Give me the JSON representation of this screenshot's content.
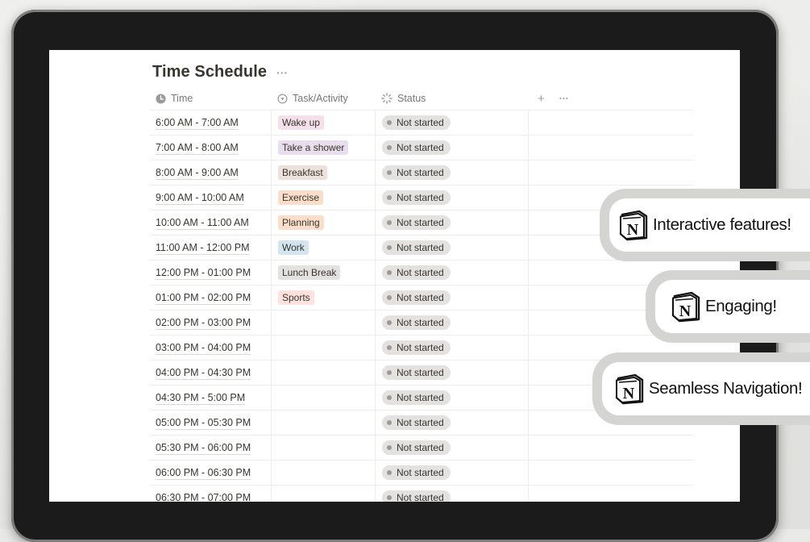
{
  "page": {
    "title": "Time Schedule",
    "title_more": "···"
  },
  "table": {
    "columns": {
      "time": "Time",
      "task": "Task/Activity",
      "status": "Status",
      "add": "+",
      "more": "···"
    },
    "rows": [
      {
        "time": "6:00 AM - 7:00 AM",
        "task": "Wake up",
        "task_color": "#f5e0e9",
        "status": "Not started"
      },
      {
        "time": "7:00 AM - 8:00 AM",
        "task": "Take a shower",
        "task_color": "#e8deee",
        "status": "Not started"
      },
      {
        "time": "8:00 AM - 9:00 AM",
        "task": "Breakfast",
        "task_color": "#eee0da",
        "status": "Not started"
      },
      {
        "time": "9:00 AM - 10:00 AM",
        "task": "Exercise",
        "task_color": "#fadec9",
        "status": "Not started"
      },
      {
        "time": "10:00 AM - 11:00 AM",
        "task": "Planning",
        "task_color": "#fadec9",
        "status": "Not started"
      },
      {
        "time": "11:00 AM - 12:00 PM",
        "task": "Work",
        "task_color": "#d3e5ef",
        "status": "Not started"
      },
      {
        "time": "12:00 PM - 01:00 PM",
        "task": "Lunch Break",
        "task_color": "#e3e2e0",
        "status": "Not started"
      },
      {
        "time": "01:00 PM - 02:00 PM",
        "task": "Sports",
        "task_color": "#ffe2dd",
        "status": "Not started"
      },
      {
        "time": "02:00 PM - 03:00 PM",
        "task": "",
        "task_color": "",
        "status": "Not started"
      },
      {
        "time": "03:00 PM - 04:00 PM",
        "task": "",
        "task_color": "",
        "status": "Not started"
      },
      {
        "time": "04:00 PM - 04:30 PM",
        "task": "",
        "task_color": "",
        "status": "Not started"
      },
      {
        "time": "04:30 PM - 5:00 PM",
        "task": "",
        "task_color": "",
        "status": "Not started"
      },
      {
        "time": "05:00 PM - 05:30 PM",
        "task": "",
        "task_color": "",
        "status": "Not started"
      },
      {
        "time": "05:30 PM - 06:00 PM",
        "task": "",
        "task_color": "",
        "status": "Not started"
      },
      {
        "time": "06:00 PM - 06:30 PM",
        "task": "",
        "task_color": "",
        "status": "Not started"
      },
      {
        "time": "06:30 PM - 07:00 PM",
        "task": "",
        "task_color": "",
        "status": "Not started"
      }
    ]
  },
  "badges": [
    {
      "text": "Interactive features!",
      "icon": "notion-logo-icon"
    },
    {
      "text": "Engaging!",
      "icon": "notion-logo-icon"
    },
    {
      "text": "Seamless Navigation!",
      "icon": "notion-logo-icon"
    }
  ]
}
